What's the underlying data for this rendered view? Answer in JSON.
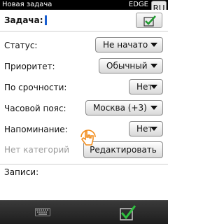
{
  "statusbar": {
    "title": "Новая задача",
    "network": "EDGE",
    "lang": "RU"
  },
  "task": {
    "label": "Задача:",
    "value": ""
  },
  "fields": {
    "status": {
      "label": "Статус:",
      "value": "Не начато"
    },
    "priority": {
      "label": "Приоритет:",
      "value": "Обычный"
    },
    "urgency": {
      "label": "По срочности:",
      "value": "Нет"
    },
    "timezone": {
      "label": "Часовой пояс:",
      "value": "Москва (+3)"
    },
    "reminder": {
      "label": "Напоминание:",
      "value": "Нет"
    },
    "category": {
      "label": "Нет категорий",
      "button": "Редактировать"
    }
  },
  "notes": {
    "label": "Записи:"
  },
  "icons": {
    "confirm_top": "checkmark-icon",
    "keyboard": "keyboard-icon",
    "confirm_bottom": "checkmark-icon",
    "cursor": "touch-cursor-icon"
  },
  "colors": {
    "accent": "#1e9a2e",
    "cursor": "#1a5fd0",
    "topbar": "#000000",
    "bottombar": "#2a2a2a",
    "pointer": "#f28c1a"
  }
}
